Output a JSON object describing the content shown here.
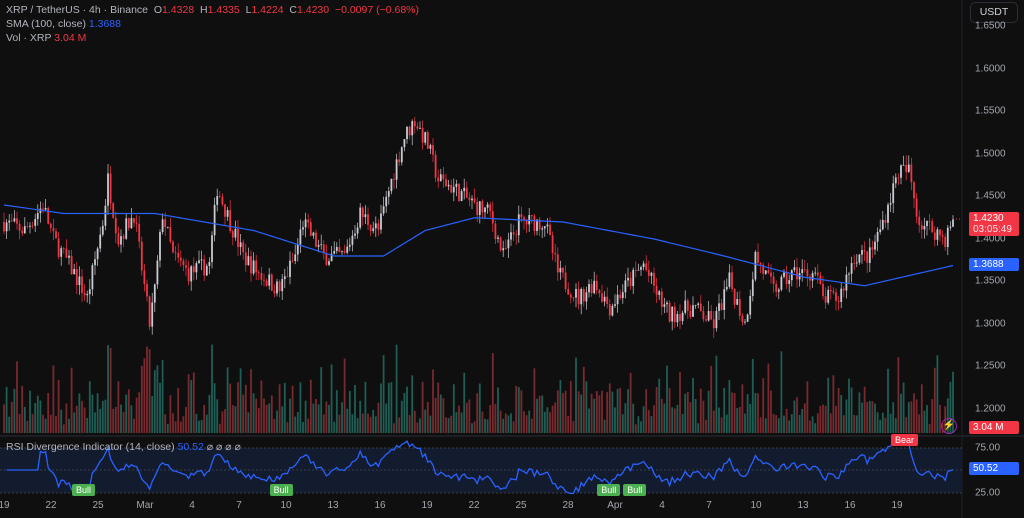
{
  "header": {
    "symbol": "XRP / TetherUS · 4h · Binance",
    "o_label": "O",
    "open": "1.4328",
    "h_label": "H",
    "high": "1.4335",
    "l_label": "L",
    "low": "1.4224",
    "c_label": "C",
    "close": "1.4230",
    "change": "−0.0097 (−0.68%)"
  },
  "sma": {
    "label": "SMA (100, close)",
    "value": "1.3688"
  },
  "vol": {
    "label": "Vol · XRP",
    "value": "3.04 M"
  },
  "currency_button": "USDT",
  "price_ticks": [
    "1.6500",
    "1.6000",
    "1.5500",
    "1.5000",
    "1.4500",
    "1.4000",
    "1.3500",
    "1.3000",
    "1.2500",
    "1.2000"
  ],
  "last_price": {
    "value": "1.4230",
    "countdown": "03:05:49"
  },
  "rsi": {
    "label": "RSI Divergence Indicator (14, close)",
    "value": "50.52",
    "icons": "⌀ ⌀ ⌀ ⌀",
    "ticks": [
      "75.00",
      "25.00"
    ],
    "bull_label": "Bull",
    "bear_label": "Bear"
  },
  "time_ticks": [
    "19",
    "22",
    "25",
    "Mar",
    "4",
    "7",
    "10",
    "13",
    "16",
    "19",
    "22",
    "25",
    "28",
    "Apr",
    "4",
    "7",
    "10",
    "13",
    "16",
    "19"
  ],
  "colors": {
    "up": "#c8cbd2",
    "down": "#f23645",
    "sma": "#2962ff",
    "rsi": "#2962ff",
    "bull": "#4caf50",
    "bear": "#f23645"
  },
  "chart_data": {
    "type": "candlestick",
    "timeframe": "4h",
    "price_range": [
      1.19,
      1.66
    ],
    "close_keyframes": [
      [
        0,
        1.42
      ],
      [
        8,
        1.41
      ],
      [
        15,
        1.44
      ],
      [
        19,
        1.4
      ],
      [
        27,
        1.36
      ],
      [
        32,
        1.33
      ],
      [
        38,
        1.42
      ],
      [
        40,
        1.47
      ],
      [
        44,
        1.4
      ],
      [
        50,
        1.43
      ],
      [
        56,
        1.3
      ],
      [
        58,
        1.34
      ],
      [
        61,
        1.43
      ],
      [
        65,
        1.38
      ],
      [
        71,
        1.36
      ],
      [
        79,
        1.37
      ],
      [
        82,
        1.46
      ],
      [
        87,
        1.42
      ],
      [
        92,
        1.38
      ],
      [
        98,
        1.36
      ],
      [
        106,
        1.34
      ],
      [
        112,
        1.38
      ],
      [
        115,
        1.42
      ],
      [
        123,
        1.38
      ],
      [
        131,
        1.38
      ],
      [
        137,
        1.43
      ],
      [
        144,
        1.41
      ],
      [
        150,
        1.48
      ],
      [
        154,
        1.52
      ],
      [
        158,
        1.54
      ],
      [
        163,
        1.51
      ],
      [
        167,
        1.47
      ],
      [
        173,
        1.46
      ],
      [
        181,
        1.44
      ],
      [
        187,
        1.43
      ],
      [
        192,
        1.38
      ],
      [
        198,
        1.42
      ],
      [
        208,
        1.42
      ],
      [
        213,
        1.36
      ],
      [
        221,
        1.33
      ],
      [
        227,
        1.35
      ],
      [
        233,
        1.32
      ],
      [
        238,
        1.34
      ],
      [
        246,
        1.37
      ],
      [
        252,
        1.33
      ],
      [
        256,
        1.31
      ],
      [
        265,
        1.32
      ],
      [
        273,
        1.3
      ],
      [
        279,
        1.35
      ],
      [
        285,
        1.3
      ],
      [
        289,
        1.38
      ],
      [
        296,
        1.34
      ],
      [
        304,
        1.36
      ],
      [
        312,
        1.36
      ],
      [
        315,
        1.33
      ],
      [
        321,
        1.33
      ],
      [
        327,
        1.38
      ],
      [
        333,
        1.38
      ],
      [
        338,
        1.42
      ],
      [
        344,
        1.48
      ],
      [
        348,
        1.48
      ],
      [
        352,
        1.42
      ],
      [
        358,
        1.41
      ],
      [
        362,
        1.4
      ],
      [
        365,
        1.423
      ]
    ],
    "sma_keyframes": [
      [
        0,
        1.44
      ],
      [
        23,
        1.43
      ],
      [
        58,
        1.43
      ],
      [
        96,
        1.41
      ],
      [
        127,
        1.38
      ],
      [
        146,
        1.38
      ],
      [
        162,
        1.41
      ],
      [
        181,
        1.425
      ],
      [
        215,
        1.42
      ],
      [
        250,
        1.4
      ],
      [
        277,
        1.38
      ],
      [
        308,
        1.355
      ],
      [
        331,
        1.345
      ],
      [
        365,
        1.3688
      ]
    ],
    "signals": [
      {
        "type": "Bull",
        "bar": 30
      },
      {
        "type": "Bull",
        "bar": 106
      },
      {
        "type": "Bull",
        "bar": 232
      },
      {
        "type": "Bull",
        "bar": 242
      },
      {
        "type": "Bear",
        "bar": 345
      }
    ]
  }
}
